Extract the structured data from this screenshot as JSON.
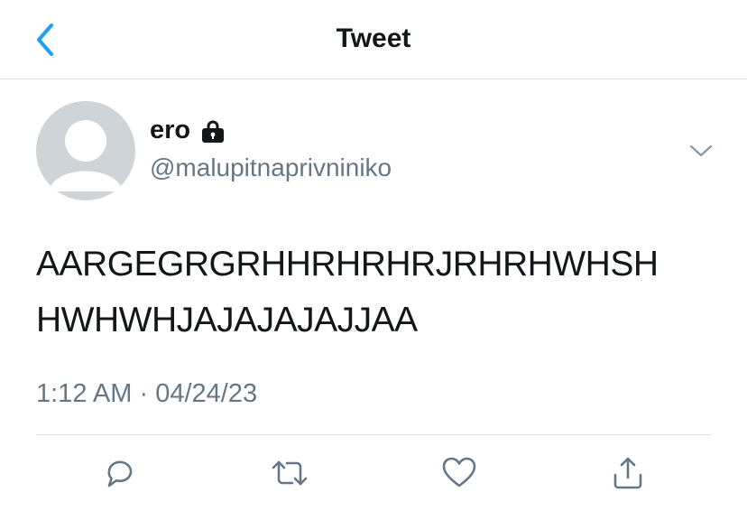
{
  "nav": {
    "title": "Tweet",
    "back_icon": "chevron-left-icon"
  },
  "tweet": {
    "author": {
      "display_name": "ero",
      "handle": "@malupitnaprivniniko",
      "protected": true,
      "lock_icon": "lock-icon",
      "avatar": "default-avatar"
    },
    "text_lines": [
      "AARGEGRGRHHRHRHRJRHRHWHSH",
      "HWHWHJAJAJAJAJJAA"
    ],
    "time": "1:12 AM",
    "separator": "·",
    "date": "04/24/23"
  },
  "actions": [
    {
      "name": "reply",
      "icon": "reply-icon"
    },
    {
      "name": "retweet",
      "icon": "retweet-icon"
    },
    {
      "name": "like",
      "icon": "heart-icon"
    },
    {
      "name": "share",
      "icon": "share-icon"
    }
  ],
  "colors": {
    "accent": "#1da1f2",
    "text": "#14171a",
    "secondary": "#657786",
    "divider": "#d8dde1",
    "avatar_bg": "#cfd4d8"
  }
}
